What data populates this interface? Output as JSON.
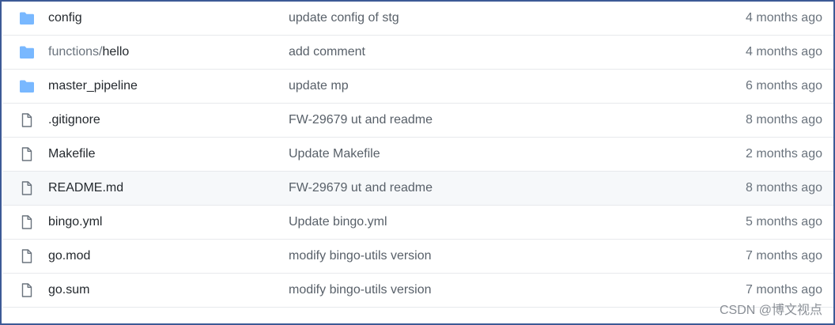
{
  "files": [
    {
      "type": "folder",
      "icon": "folder-icon",
      "name_prefix": "",
      "name": "config",
      "message": "update config of stg",
      "age": "4 months ago",
      "highlight": false
    },
    {
      "type": "folder",
      "icon": "folder-icon",
      "name_prefix": "functions/",
      "name": "hello",
      "message": "add comment",
      "age": "4 months ago",
      "highlight": false
    },
    {
      "type": "folder",
      "icon": "folder-icon",
      "name_prefix": "",
      "name": "master_pipeline",
      "message": "update mp",
      "age": "6 months ago",
      "highlight": false
    },
    {
      "type": "file",
      "icon": "file-icon",
      "name_prefix": "",
      "name": ".gitignore",
      "message": "FW-29679 ut and readme",
      "age": "8 months ago",
      "highlight": false
    },
    {
      "type": "file",
      "icon": "file-icon",
      "name_prefix": "",
      "name": "Makefile",
      "message": "Update Makefile",
      "age": "2 months ago",
      "highlight": false
    },
    {
      "type": "file",
      "icon": "file-icon",
      "name_prefix": "",
      "name": "README.md",
      "message": "FW-29679 ut and readme",
      "age": "8 months ago",
      "highlight": true
    },
    {
      "type": "file",
      "icon": "file-icon",
      "name_prefix": "",
      "name": "bingo.yml",
      "message": "Update bingo.yml",
      "age": "5 months ago",
      "highlight": false
    },
    {
      "type": "file",
      "icon": "file-icon",
      "name_prefix": "",
      "name": "go.mod",
      "message": "modify bingo-utils version",
      "age": "7 months ago",
      "highlight": false
    },
    {
      "type": "file",
      "icon": "file-icon",
      "name_prefix": "",
      "name": "go.sum",
      "message": "modify bingo-utils version",
      "age": "7 months ago",
      "highlight": false
    }
  ],
  "watermark": "CSDN @博文视点",
  "colors": {
    "folder": "#79b8ff",
    "file_outline": "#6a737d",
    "frame_border": "#3c5a96",
    "row_highlight": "#f6f8fa"
  }
}
